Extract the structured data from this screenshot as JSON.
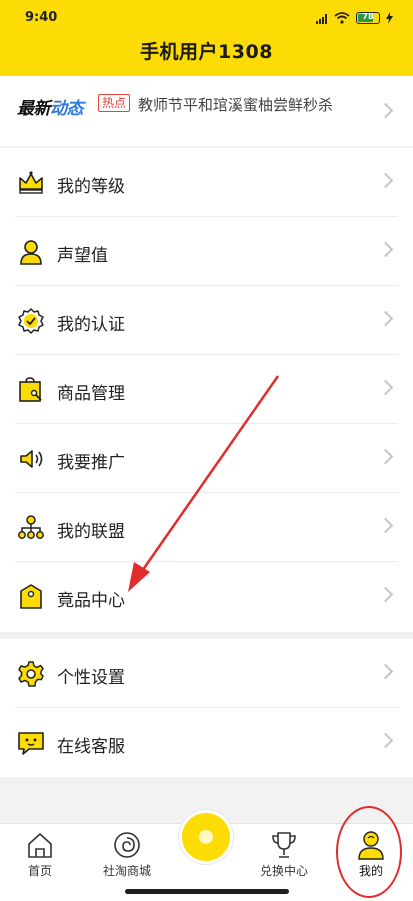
{
  "status_bar": {
    "time": "9:40",
    "battery": "78",
    "battery_level_pct": 78
  },
  "header": {
    "title": "手机用户1308"
  },
  "news": {
    "logo_part1": "最新",
    "logo_part2": "动态",
    "tag": "热点",
    "text": "教师节平和琯溪蜜柚尝鲜秒杀"
  },
  "menu": {
    "items": [
      {
        "label": "我的等级",
        "icon": "crown-icon"
      },
      {
        "label": "声望值",
        "icon": "user-icon"
      },
      {
        "label": "我的认证",
        "icon": "verified-badge-icon"
      },
      {
        "label": "商品管理",
        "icon": "shopping-bag-icon"
      },
      {
        "label": "我要推广",
        "icon": "speaker-icon"
      },
      {
        "label": "我的联盟",
        "icon": "org-chart-icon"
      },
      {
        "label": "竟品中心",
        "icon": "price-tag-icon"
      }
    ],
    "settings": [
      {
        "label": "个性设置",
        "icon": "gear-icon"
      },
      {
        "label": "在线客服",
        "icon": "chat-bubble-icon"
      }
    ]
  },
  "tabbar": {
    "tabs": [
      {
        "label": "首页",
        "icon": "home-icon"
      },
      {
        "label": "社淘商城",
        "icon": "swirl-icon"
      },
      {
        "label": "",
        "icon": "center-circle-icon"
      },
      {
        "label": "兑换中心",
        "icon": "trophy-icon"
      },
      {
        "label": "我的",
        "icon": "profile-icon"
      }
    ],
    "active_tab": "我的"
  },
  "colors": {
    "brand_yellow": "#fcdc04",
    "annotation_red": "#e22c2c",
    "tag_red": "#e6433a",
    "logo_blue": "#2f7bd8"
  }
}
